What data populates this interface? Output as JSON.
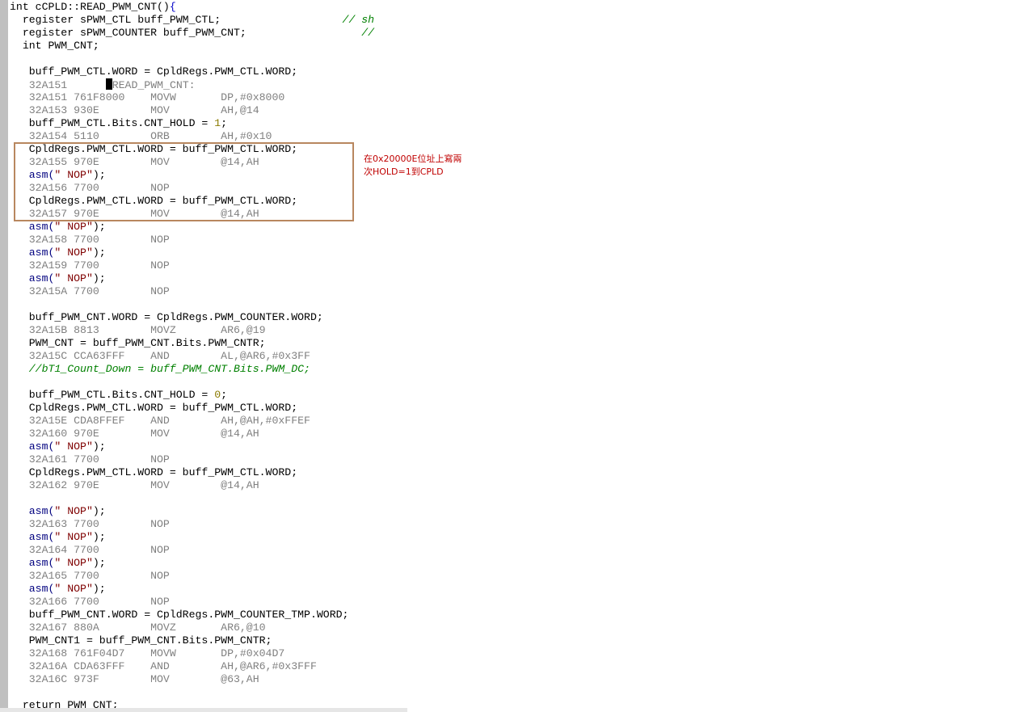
{
  "editor": {
    "lines": [
      [
        {
          "t": "int cCPLD::READ_PWM_CNT()"
        },
        {
          "t": "{",
          "c": "brace"
        }
      ],
      [
        {
          "t": "  register sPWM_CTL buff_PWM_CTL;                   "
        },
        {
          "t": "// sh",
          "c": "cm"
        }
      ],
      [
        {
          "t": "  register sPWM_COUNTER buff_PWM_CNT;                  "
        },
        {
          "t": "// ",
          "c": "cm"
        }
      ],
      [
        {
          "t": "  int PWM_CNT;"
        }
      ],
      [
        {
          "t": ""
        }
      ],
      [
        {
          "t": "   buff_PWM_CTL.WORD = CpldRegs.PWM_CTL.WORD;"
        }
      ],
      [
        {
          "t": "   32A151      ",
          "c": "dis"
        },
        {
          "caret": true
        },
        {
          "t": "READ_PWM_CNT:",
          "c": "dis"
        }
      ],
      [
        {
          "t": "   32A151 761F8000    MOVW       DP,#0x8000",
          "c": "dis"
        }
      ],
      [
        {
          "t": "   32A153 930E        MOV        AH,@14",
          "c": "dis"
        }
      ],
      [
        {
          "t": "   buff_PWM_CTL.Bits.CNT_HOLD = "
        },
        {
          "t": "1",
          "c": "num"
        },
        {
          "t": ";"
        }
      ],
      [
        {
          "t": "   32A154 5110        ORB        AH,#0x10",
          "c": "dis"
        }
      ],
      [
        {
          "t": "   CpldRegs.PWM_CTL.WORD = buff_PWM_CTL.WORD;"
        }
      ],
      [
        {
          "t": "   32A155 970E        MOV        @14,AH",
          "c": "dis"
        }
      ],
      [
        {
          "t": "   asm(",
          "c": "kw"
        },
        {
          "t": "\" NOP\"",
          "c": "str"
        },
        {
          "t": ");"
        }
      ],
      [
        {
          "t": "   32A156 7700        NOP",
          "c": "dis"
        }
      ],
      [
        {
          "t": "   CpldRegs.PWM_CTL.WORD = buff_PWM_CTL.WORD;"
        }
      ],
      [
        {
          "t": "   32A157 970E        MOV        @14,AH",
          "c": "dis"
        }
      ],
      [
        {
          "t": "   asm(",
          "c": "kw"
        },
        {
          "t": "\" NOP\"",
          "c": "str"
        },
        {
          "t": ");"
        }
      ],
      [
        {
          "t": "   32A158 7700        NOP",
          "c": "dis"
        }
      ],
      [
        {
          "t": "   asm(",
          "c": "kw"
        },
        {
          "t": "\" NOP\"",
          "c": "str"
        },
        {
          "t": ");"
        }
      ],
      [
        {
          "t": "   32A159 7700        NOP",
          "c": "dis"
        }
      ],
      [
        {
          "t": "   asm(",
          "c": "kw"
        },
        {
          "t": "\" NOP\"",
          "c": "str"
        },
        {
          "t": ");"
        }
      ],
      [
        {
          "t": "   32A15A 7700        NOP",
          "c": "dis"
        }
      ],
      [
        {
          "t": ""
        }
      ],
      [
        {
          "t": "   buff_PWM_CNT.WORD = CpldRegs.PWM_COUNTER.WORD;"
        }
      ],
      [
        {
          "t": "   32A15B 8813        MOVZ       AR6,@19",
          "c": "dis"
        }
      ],
      [
        {
          "t": "   PWM_CNT = buff_PWM_CNT.Bits.PWM_CNTR;"
        }
      ],
      [
        {
          "t": "   32A15C CCA63FFF    AND        AL,@AR6,#0x3FF",
          "c": "dis"
        }
      ],
      [
        {
          "t": "   //bT1_Count_Down = buff_PWM_CNT.Bits.PWM_DC;",
          "c": "cm"
        }
      ],
      [
        {
          "t": ""
        }
      ],
      [
        {
          "t": "   buff_PWM_CTL.Bits.CNT_HOLD = "
        },
        {
          "t": "0",
          "c": "num"
        },
        {
          "t": ";"
        }
      ],
      [
        {
          "t": "   CpldRegs.PWM_CTL.WORD = buff_PWM_CTL.WORD;"
        }
      ],
      [
        {
          "t": "   32A15E CDA8FFEF    AND        AH,@AH,#0xFFEF",
          "c": "dis"
        }
      ],
      [
        {
          "t": "   32A160 970E        MOV        @14,AH",
          "c": "dis"
        }
      ],
      [
        {
          "t": "   asm(",
          "c": "kw"
        },
        {
          "t": "\" NOP\"",
          "c": "str"
        },
        {
          "t": ");"
        }
      ],
      [
        {
          "t": "   32A161 7700        NOP",
          "c": "dis"
        }
      ],
      [
        {
          "t": "   CpldRegs.PWM_CTL.WORD = buff_PWM_CTL.WORD;"
        }
      ],
      [
        {
          "t": "   32A162 970E        MOV        @14,AH",
          "c": "dis"
        }
      ],
      [
        {
          "t": ""
        }
      ],
      [
        {
          "t": "   asm(",
          "c": "kw"
        },
        {
          "t": "\" NOP\"",
          "c": "str"
        },
        {
          "t": ");"
        }
      ],
      [
        {
          "t": "   32A163 7700        NOP",
          "c": "dis"
        }
      ],
      [
        {
          "t": "   asm(",
          "c": "kw"
        },
        {
          "t": "\" NOP\"",
          "c": "str"
        },
        {
          "t": ");"
        }
      ],
      [
        {
          "t": "   32A164 7700        NOP",
          "c": "dis"
        }
      ],
      [
        {
          "t": "   asm(",
          "c": "kw"
        },
        {
          "t": "\" NOP\"",
          "c": "str"
        },
        {
          "t": ");"
        }
      ],
      [
        {
          "t": "   32A165 7700        NOP",
          "c": "dis"
        }
      ],
      [
        {
          "t": "   asm(",
          "c": "kw"
        },
        {
          "t": "\" NOP\"",
          "c": "str"
        },
        {
          "t": ");"
        }
      ],
      [
        {
          "t": "   32A166 7700        NOP",
          "c": "dis"
        }
      ],
      [
        {
          "t": "   buff_PWM_CNT.WORD = CpldRegs.PWM_COUNTER_TMP.WORD;"
        }
      ],
      [
        {
          "t": "   32A167 880A        MOVZ       AR6,@10",
          "c": "dis"
        }
      ],
      [
        {
          "t": "   PWM_CNT1 = buff_PWM_CNT.Bits.PWM_CNTR;"
        }
      ],
      [
        {
          "t": "   32A168 761F04D7    MOVW       DP,#0x04D7",
          "c": "dis"
        }
      ],
      [
        {
          "t": "   32A16A CDA63FFF    AND        AH,@AR6,#0x3FFF",
          "c": "dis"
        }
      ],
      [
        {
          "t": "   32A16C 973F        MOV        @63,AH",
          "c": "dis"
        }
      ],
      [
        {
          "t": ""
        }
      ],
      [
        {
          "t": "  return PWM_CNT;"
        }
      ]
    ]
  },
  "annotation": {
    "note_line1": "在0x20000E位址上寫兩",
    "note_line2": "次HOLD=1到CPLD",
    "box_color": "#b8875f",
    "text_color": "#c00000"
  }
}
